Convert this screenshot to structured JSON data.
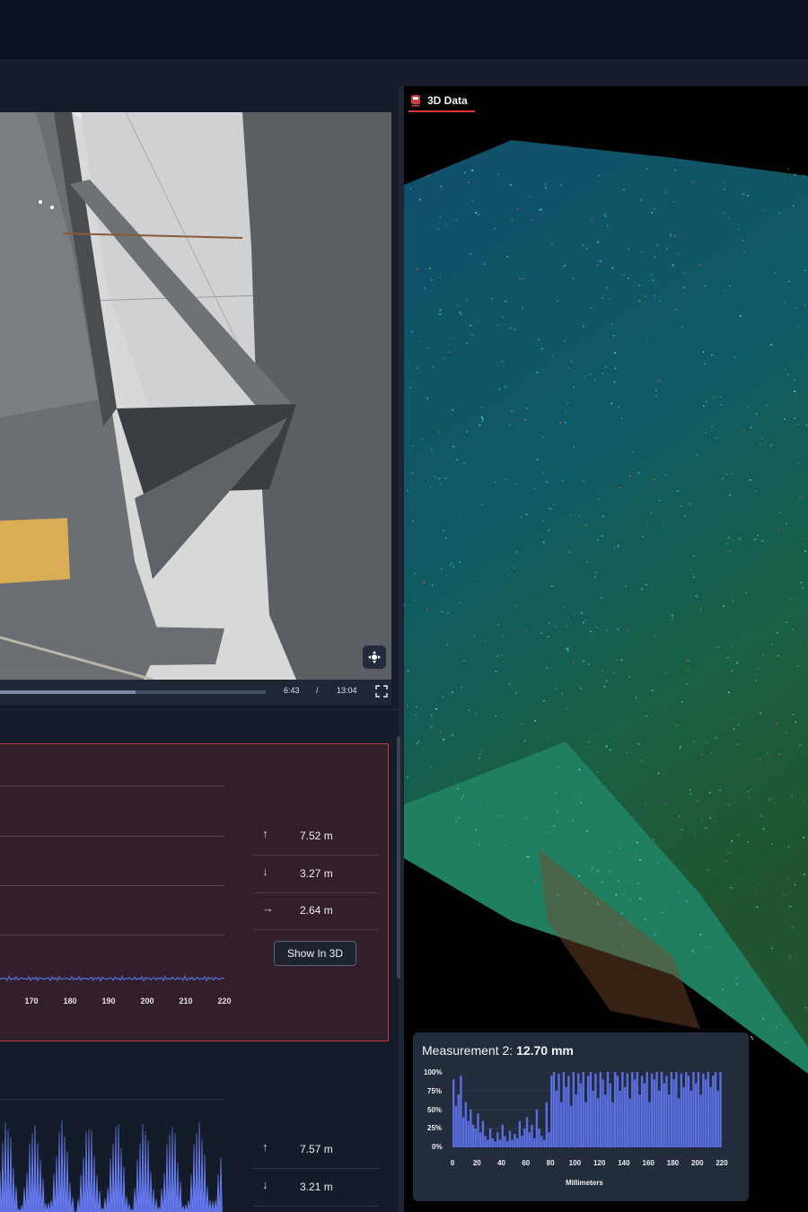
{
  "video": {
    "current_time": "6:43",
    "separator": "/",
    "duration": "13:04",
    "progress": 0.51
  },
  "measurement1": {
    "x_ticks": [
      "170",
      "180",
      "190",
      "200",
      "210",
      "220"
    ],
    "stats": [
      {
        "arrow": "↑",
        "value": "7.52 m"
      },
      {
        "arrow": "↓",
        "value": "3.27 m"
      },
      {
        "arrow": "→",
        "value": "2.64 m"
      }
    ],
    "show_3d_label": "Show In 3D"
  },
  "measurement2_left": {
    "stats": [
      {
        "arrow": "↑",
        "value": "7.57 m"
      },
      {
        "arrow": "↓",
        "value": "3.21 m"
      }
    ]
  },
  "panel_3d": {
    "tab_label": "3D Data"
  },
  "histogram": {
    "title_prefix": "Measurement 2: ",
    "title_value": "12.70 mm",
    "x_axis_title": "Millimeters",
    "colors": {
      "bar": "#5a6ee0",
      "accent": "#d23b3b"
    }
  },
  "chart_data": {
    "type": "area",
    "title": "Measurement 2: 12.70 mm",
    "xlabel": "Millimeters",
    "ylabel": "",
    "x_ticks": [
      "0",
      "20",
      "40",
      "60",
      "80",
      "100",
      "120",
      "140",
      "160",
      "180",
      "200",
      "220"
    ],
    "y_ticks": [
      "100%",
      "75%",
      "50%",
      "25%",
      "0%"
    ],
    "xlim": [
      0,
      220
    ],
    "ylim": [
      0,
      100
    ],
    "series": [
      {
        "x": [
          0,
          2,
          4,
          6,
          8,
          10,
          12,
          14,
          16,
          18,
          20,
          22,
          24,
          26,
          28,
          30,
          32,
          34,
          36,
          38,
          40,
          42,
          44,
          46,
          48,
          50,
          52,
          54,
          56,
          58,
          60,
          62,
          64,
          66,
          68,
          70,
          72,
          74,
          76,
          78,
          80,
          82,
          84,
          86,
          88,
          90,
          92,
          94,
          96,
          98,
          100,
          102,
          104,
          106,
          108,
          110,
          112,
          114,
          116,
          118,
          120,
          122,
          124,
          126,
          128,
          130,
          132,
          134,
          136,
          138,
          140,
          142,
          144,
          146,
          148,
          150,
          152,
          154,
          156,
          158,
          160,
          162,
          164,
          166,
          168,
          170,
          172,
          174,
          176,
          178,
          180,
          182,
          184,
          186,
          188,
          190,
          192,
          194,
          196,
          198,
          200,
          202,
          204,
          206,
          208,
          210,
          212,
          214,
          216,
          218,
          220
        ],
        "values": [
          90,
          55,
          70,
          95,
          40,
          60,
          35,
          50,
          30,
          25,
          45,
          20,
          35,
          15,
          10,
          25,
          12,
          8,
          20,
          10,
          30,
          15,
          8,
          22,
          10,
          18,
          12,
          35,
          15,
          25,
          40,
          20,
          30,
          12,
          50,
          25,
          15,
          10,
          60,
          20,
          95,
          100,
          75,
          98,
          60,
          100,
          80,
          95,
          55,
          100,
          70,
          98,
          85,
          100,
          60,
          95,
          100,
          75,
          98,
          65,
          100,
          90,
          70,
          100,
          85,
          60,
          100,
          95,
          75,
          100,
          80,
          98,
          65,
          100,
          90,
          100,
          70,
          95,
          85,
          100,
          60,
          98,
          90,
          100,
          75,
          100,
          85,
          95,
          70,
          100,
          90,
          100,
          65,
          98,
          80,
          100,
          95,
          75,
          100,
          85,
          100,
          70,
          98,
          90,
          100,
          80,
          95,
          100,
          75,
          100,
          90
        ]
      }
    ]
  }
}
